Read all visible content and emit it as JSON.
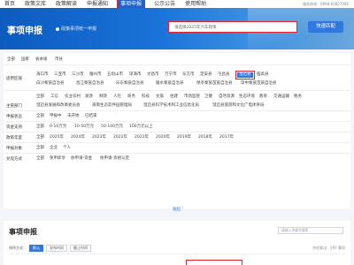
{
  "nav": {
    "items": [
      "首页",
      "政策文库",
      "政策解读",
      "申报通知",
      "事项申报",
      "公示公告",
      "使用帮助"
    ],
    "active_index": 4,
    "hotline": "服务热线：0898-60827006"
  },
  "banner": {
    "title": "事项申报",
    "subtitle": "政策事项统一申报",
    "search_value": "请选择2025年汽车政策",
    "search_button": "快速匹配"
  },
  "filters": {
    "region": {
      "label": "适用区域",
      "tabs": [
        "全部",
        "国家",
        "省本级",
        "市县"
      ],
      "line1": [
        "海口市",
        "三亚市",
        "三沙市",
        "儋州市",
        "五指山市",
        "琼海市",
        "文昌市",
        "万宁市",
        "东方市",
        "定安县",
        "屯昌县",
        "澄迈县",
        "临高县"
      ],
      "line1_selected": "澄迈县",
      "line2": [
        "白沙黎族自治县",
        "昌江黎族自治县",
        "乐东黎族自治县",
        "陵水黎族自治县",
        "保亭黎族苗族自治县",
        "琼中黎族苗族自治县"
      ]
    },
    "department": {
      "label": "主管部门",
      "line1": [
        "全部",
        "工信",
        "农业农村",
        "发改",
        "财政",
        "人社",
        "商务",
        "科技",
        "文旅",
        "住建",
        "市场监管",
        "卫健",
        "自然资源",
        "生态环境",
        "教育",
        "交通运输",
        "税务"
      ],
      "line2": [
        "澄迈县发展和改革委员会",
        "海南生态软件园管理局",
        "澄迈县科学技术和工业信息化局",
        "澄迈县旅游和文化广电体育局"
      ]
    },
    "status": {
      "label": "申报状态",
      "items": [
        "全部",
        "申报中",
        "未开始",
        "已结束"
      ]
    },
    "amount": {
      "label": "资金支持",
      "items": [
        "全部",
        "0-10万元",
        "10-50万元",
        "50-100万元",
        "100万元以上"
      ]
    },
    "year": {
      "label": "政策年度",
      "items": [
        "全部",
        "2025年",
        "2024年",
        "2023年",
        "2022年",
        "2021年",
        "2020年",
        "2019年",
        "2018年",
        "2017年"
      ]
    },
    "target": {
      "label": "申报对象",
      "items": [
        "全部",
        "企业",
        "个人"
      ]
    },
    "method": {
      "label": "兑现方式",
      "items": [
        "全部",
        "免申即享",
        "依申请-资金",
        "依申请-资格认定"
      ]
    },
    "collapse_label": "收起"
  },
  "results": {
    "title": "事项申报",
    "search_placeholder": "请输入关键字搜索",
    "sort_label": "排序方式：",
    "sort_options": [
      "默认",
      "发布时间",
      "截止时间"
    ],
    "count_text": "共检索出：297 事项"
  }
}
